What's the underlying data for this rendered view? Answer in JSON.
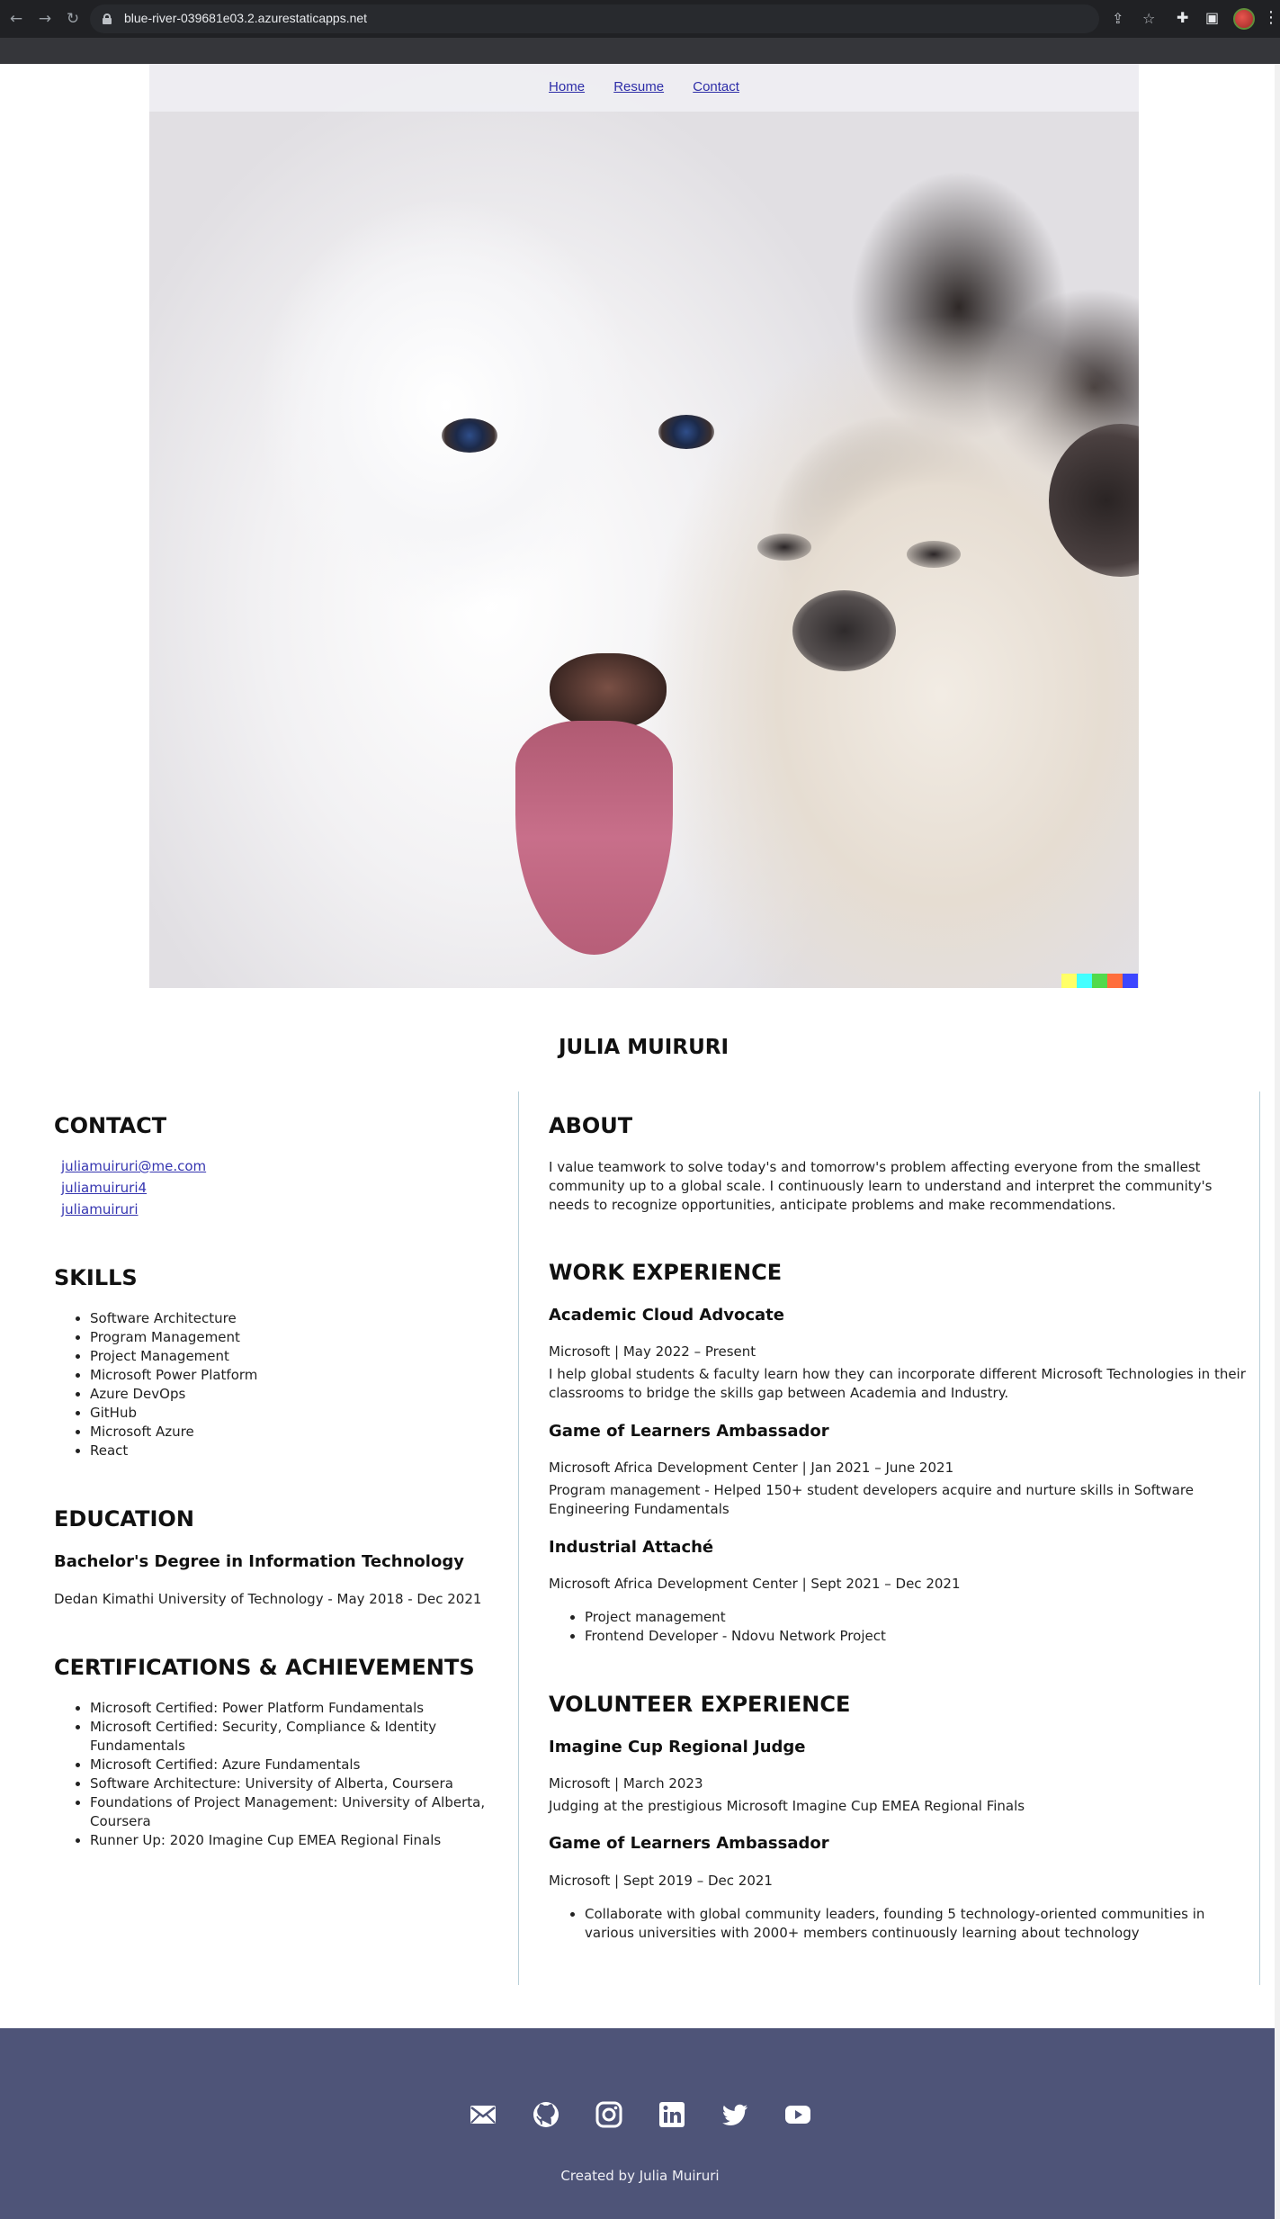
{
  "browser": {
    "url": "blue-river-039681e03.2.azurestaticapps.net",
    "back_glyph": "←",
    "forward_glyph": "→",
    "reload_glyph": "↻",
    "share_glyph": "⇪",
    "star_glyph": "☆",
    "extensions_glyph": "✚",
    "sidepanel_glyph": "▣",
    "menu_glyph": "⋮"
  },
  "nav": {
    "items": [
      {
        "label": "Home"
      },
      {
        "label": "Resume"
      },
      {
        "label": "Contact"
      }
    ]
  },
  "hero": {
    "watermark_colors": [
      "#ffff66",
      "#42ffff",
      "#51da4c",
      "#ff6e3c",
      "#3c46ff"
    ]
  },
  "name": "JULIA MUIRURI",
  "contact": {
    "heading": "CONTACT",
    "email": "juliamuiruri@me.com",
    "github": "juliamuiruri4",
    "other": "juliamuiruri"
  },
  "skills": {
    "heading": "SKILLS",
    "items": [
      "Software Architecture",
      "Program Management",
      "Project Management",
      "Microsoft Power Platform",
      "Azure DevOps",
      "GitHub",
      "Microsoft Azure",
      "React"
    ]
  },
  "education": {
    "heading": "EDUCATION",
    "degree": "Bachelor's Degree in Information Technology",
    "detail": "Dedan Kimathi University of Technology - May 2018 - Dec 2021"
  },
  "certifications": {
    "heading": "CERTIFICATIONS & ACHIEVEMENTS",
    "items": [
      "Microsoft Certified: Power Platform Fundamentals",
      "Microsoft Certified: Security, Compliance & Identity Fundamentals",
      "Microsoft Certified: Azure Fundamentals",
      "Software Architecture: University of Alberta, Coursera",
      "Foundations of Project Management: University of Alberta, Coursera",
      "Runner Up: 2020 Imagine Cup EMEA Regional Finals"
    ]
  },
  "about": {
    "heading": "ABOUT",
    "text": "I value teamwork to solve today's and tomorrow's problem affecting everyone from the smallest community up to a global scale. I continuously learn to understand and interpret the community's needs to recognize opportunities, anticipate problems and make recommendations."
  },
  "work": {
    "heading": "WORK EXPERIENCE",
    "jobs": [
      {
        "title": "Academic Cloud Advocate",
        "meta": "Microsoft | May 2022 – Present",
        "desc": "I help global students & faculty learn how they can incorporate different Microsoft Technologies in their classrooms to bridge the skills gap between Academia and Industry."
      },
      {
        "title": "Game of Learners Ambassador",
        "meta": "Microsoft Africa Development Center | Jan 2021 – June 2021",
        "desc": "Program management - Helped 150+ student developers acquire and nurture skills in Software Engineering Fundamentals"
      },
      {
        "title": "Industrial Attaché",
        "meta": "Microsoft Africa Development Center | Sept 2021 – Dec 2021",
        "bullets": [
          "Project management",
          "Frontend Developer - Ndovu Network Project"
        ]
      }
    ]
  },
  "volunteer": {
    "heading": "VOLUNTEER EXPERIENCE",
    "roles": [
      {
        "title": "Imagine Cup Regional Judge",
        "meta": "Microsoft | March 2023",
        "desc": "Judging at the prestigious Microsoft Imagine Cup EMEA Regional Finals"
      },
      {
        "title": "Game of Learners Ambassador",
        "meta": "Microsoft | Sept 2019 – Dec 2021",
        "bullets": [
          "Collaborate with global community leaders, founding 5 technology-oriented communities in various universities with 2000+ members continuously learning about technology"
        ]
      }
    ]
  },
  "footer": {
    "icons": [
      "mail-icon",
      "github-icon",
      "instagram-icon",
      "linkedin-icon",
      "twitter-icon",
      "youtube-icon"
    ],
    "credit": "Created by Julia Muiruri",
    "background": "#4e5478"
  }
}
